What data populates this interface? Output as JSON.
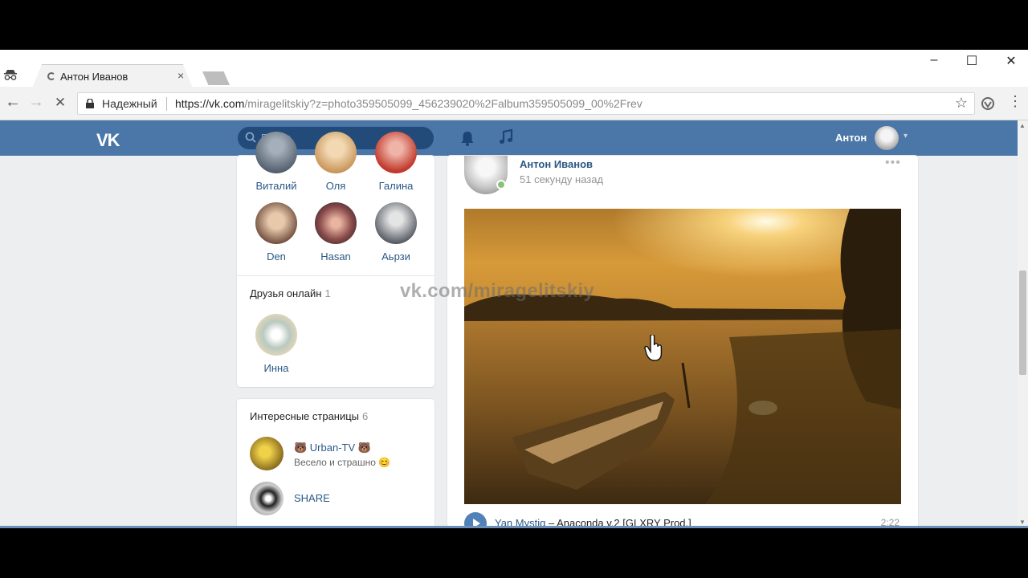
{
  "browser": {
    "tab_title": "Антон Иванов",
    "tab_close": "×",
    "window_minimize": "–",
    "window_maximize": "☐",
    "window_close": "✕",
    "back_icon": "←",
    "forward_icon": "→",
    "stop_icon": "✕",
    "security_label": "Надежный",
    "url_prefix": "https://",
    "url_host": "vk.com",
    "url_rest": "/miragelitskiy?z=photo359505099_456239020%2Falbum359505099_00%2Frev",
    "bookmark_icon": "☆",
    "menu_icon": "⋮"
  },
  "header": {
    "logo": "VK",
    "search_placeholder": "Поиск",
    "user_name": "Антон",
    "caret": "▾"
  },
  "friends": {
    "row1": [
      {
        "name": "Виталий",
        "color": "#6d7a88"
      },
      {
        "name": "Оля",
        "color": "#d7a86e"
      },
      {
        "name": "Галина",
        "color": "#c0392b"
      }
    ],
    "row2": [
      {
        "name": "Den",
        "color": "#8a6a55"
      },
      {
        "name": "Hasan",
        "color": "#7a4a4a"
      },
      {
        "name": "Aьрзи",
        "color": "#555a60"
      }
    ]
  },
  "online": {
    "title": "Друзья онлайн",
    "count": "1",
    "friend_name": "Инна"
  },
  "pages": {
    "title": "Интересные страницы",
    "count": "6",
    "items": [
      {
        "name": "🐻 Urban-TV 🐻",
        "desc": "Весело и страшно 😊"
      },
      {
        "name": "SHARE",
        "desc": ""
      }
    ]
  },
  "post": {
    "author": "Антон Иванов",
    "time": "51 секунду назад",
    "more": "•••",
    "audio": {
      "artist": "Yan Mystiq",
      "separator": " – ",
      "title": "Anaconda v.2 [GLXRY Prod.]",
      "duration": "2:22"
    }
  },
  "watermark": "vk.com/miragelitskiy",
  "colors": {
    "vk_blue": "#4a76a8",
    "link": "#2a5885",
    "online": "#8ac176"
  }
}
